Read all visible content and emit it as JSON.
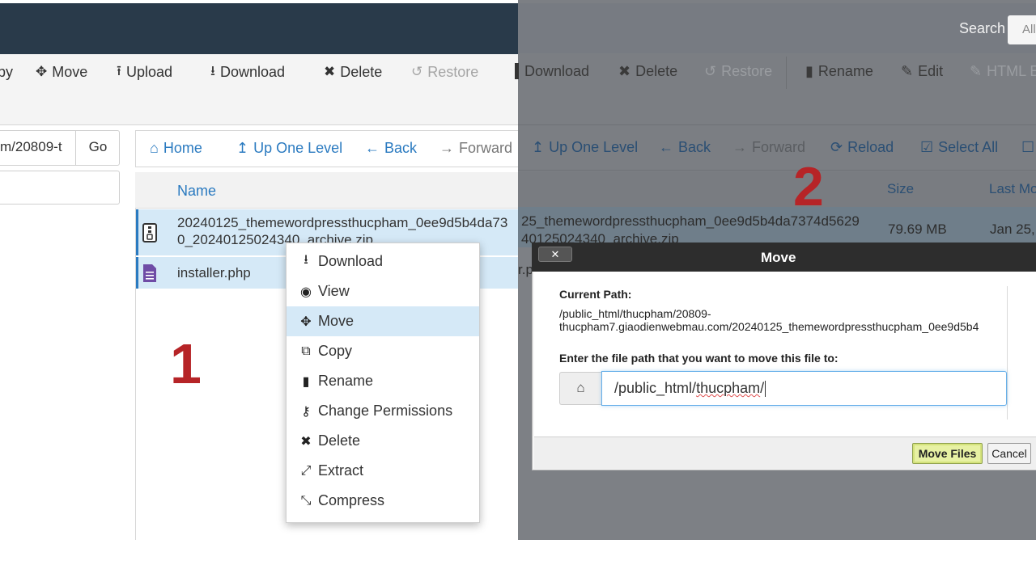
{
  "left": {
    "toolbar": {
      "copy_partial": "py",
      "move": "Move",
      "upload": "Upload",
      "download": "Download",
      "delete": "Delete",
      "restore": "Restore"
    },
    "path_value": "m/20809-t",
    "go_label": "Go",
    "nav": {
      "home": "Home",
      "up": "Up One Level",
      "back": "Back",
      "forward": "Forward"
    },
    "list": {
      "header_name": "Name",
      "file1_line1": "20240125_themewordpressthucpham_0ee9d5b4da73",
      "file1_line2": "0_20240125024340_archive.zip",
      "file2": "installer.php"
    },
    "context_menu": [
      "Download",
      "View",
      "Move",
      "Copy",
      "Rename",
      "Change Permissions",
      "Delete",
      "Extract",
      "Compress"
    ],
    "step_label": "1"
  },
  "right": {
    "search_label": "Search",
    "search_value": "All",
    "toolbar": {
      "download": "Download",
      "delete": "Delete",
      "restore": "Restore",
      "rename": "Rename",
      "edit": "Edit",
      "html_edit_partial": "HTML E"
    },
    "nav": {
      "up": "Up One Level",
      "back": "Back",
      "forward": "Forward",
      "reload": "Reload",
      "select_all": "Select All"
    },
    "list": {
      "col_size": "Size",
      "col_last_modified": "Last Mo",
      "file_line1": "25_themewordpressthucpham_0ee9d5b4da7374d5629",
      "file_line2": "40125024340_archive.zip",
      "size": "79.69 MB",
      "date": "Jan 25,",
      "php_partial": "r.p"
    },
    "step_label": "2",
    "dialog": {
      "title": "Move",
      "close": "✕",
      "current_path_label": "Current Path:",
      "current_path_line1": "/public_html/thucpham/20809-",
      "current_path_line2": "thucpham7.giaodienwebmau.com/20240125_themewordpressthucpham_0ee9d5b4",
      "enter_label": "Enter the file path that you want to move this file to:",
      "input_prefix": "/public_html/",
      "input_spell": "thucpham",
      "input_suffix": "/",
      "move_button": "Move Files",
      "cancel_button": "Cancel"
    }
  }
}
